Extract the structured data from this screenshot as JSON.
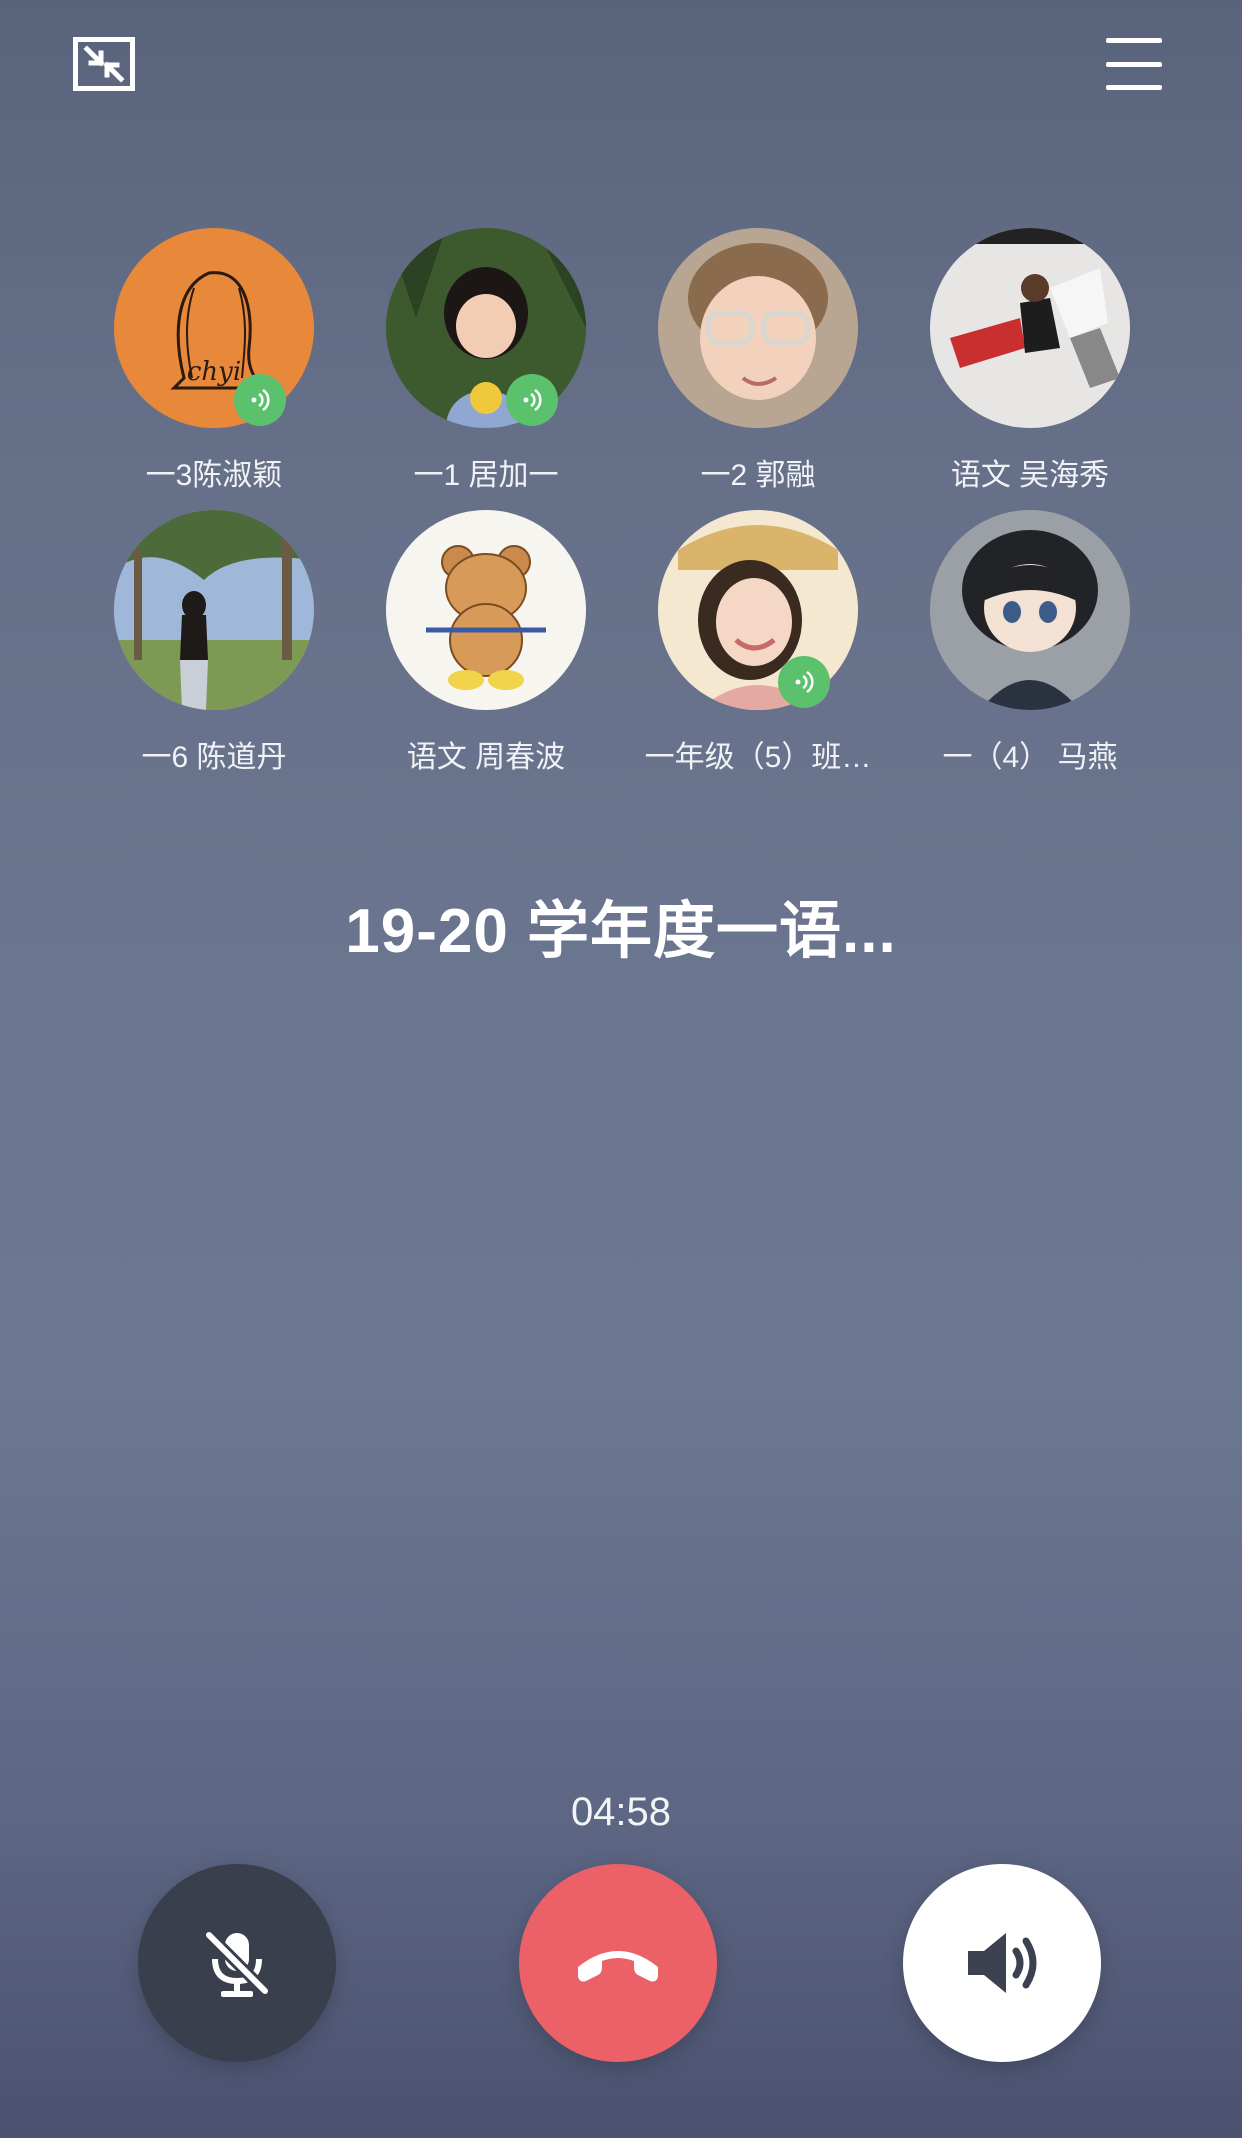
{
  "toolbar": {
    "minimize_icon": "minimize-arrows-icon",
    "menu_icon": "hamburger-menu-icon"
  },
  "members": [
    {
      "name": "一3陈淑颖",
      "speaking": true
    },
    {
      "name": "一1 居加一",
      "speaking": true
    },
    {
      "name": "一2 郭融",
      "speaking": false
    },
    {
      "name": "语文   吴海秀",
      "speaking": false
    },
    {
      "name": "一6 陈道丹",
      "speaking": false
    },
    {
      "name": "语文 周春波",
      "speaking": false
    },
    {
      "name": "一年级（5）班…",
      "speaking": true
    },
    {
      "name": "一（4）     马燕",
      "speaking": false
    }
  ],
  "group": {
    "title": "19-20 学年度一语..."
  },
  "call": {
    "duration": "04:58"
  },
  "controls": {
    "mute_icon": "microphone-off-icon",
    "hangup_icon": "phone-hangup-icon",
    "speaker_icon": "speaker-on-icon",
    "hangup_color": "#ec6068",
    "speaking_color": "#5bc16d"
  }
}
